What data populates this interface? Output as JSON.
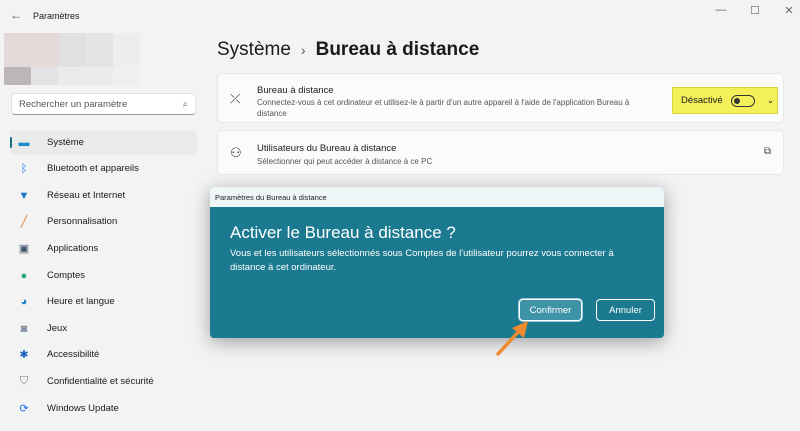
{
  "window": {
    "title": "Paramètres",
    "back_icon": "←",
    "minimize": "—",
    "maximize": "☐",
    "close": "✕"
  },
  "search": {
    "placeholder": "Rechercher un paramètre"
  },
  "sidebar": {
    "items": [
      {
        "label": "Système",
        "icon": "▬",
        "color": "#1a8bc4"
      },
      {
        "label": "Bluetooth et appareils",
        "icon": "ᛒ",
        "color": "#1a73e8"
      },
      {
        "label": "Réseau et Internet",
        "icon": "▼",
        "color": "#1a73c8"
      },
      {
        "label": "Personnalisation",
        "icon": "╱",
        "color": "#e07a30"
      },
      {
        "label": "Applications",
        "icon": "▣",
        "color": "#44546a"
      },
      {
        "label": "Comptes",
        "icon": "●",
        "color": "#2aa67a"
      },
      {
        "label": "Heure et langue",
        "icon": "◕",
        "color": "#1a80c4"
      },
      {
        "label": "Jeux",
        "icon": "◙",
        "color": "#7a8898"
      },
      {
        "label": "Accessibilité",
        "icon": "✱",
        "color": "#1a60c4"
      },
      {
        "label": "Confidentialité et sécurité",
        "icon": "⛉",
        "color": "#7a8088"
      },
      {
        "label": "Windows Update",
        "icon": "⟳",
        "color": "#1a73e8"
      }
    ]
  },
  "header": {
    "parent": "Système",
    "separator": "›",
    "current": "Bureau à distance"
  },
  "cards": [
    {
      "title": "Bureau à distance",
      "description": "Connectez-vous à cet ordinateur et utilisez-le à partir d'un autre appareil à l'aide de l'application Bureau à distance",
      "state": "Désactivé",
      "icon": "⤫"
    },
    {
      "title": "Utilisateurs du Bureau à distance",
      "description": "Sélectionner qui peut accéder à distance à ce PC",
      "icon": "⚇",
      "link_icon": "⧉"
    }
  ],
  "dialog": {
    "title": "Paramètres du Bureau à distance",
    "heading": "Activer le Bureau à distance ?",
    "message": "Vous et les utilisateurs sélectionnés sous Comptes de l'utilisateur pourrez vous connecter à distance à cet ordinateur.",
    "confirm": "Confirmer",
    "cancel": "Annuler"
  },
  "annotation": {
    "arrow_color": "#f08a30",
    "highlight_color": "#f4f05a"
  }
}
